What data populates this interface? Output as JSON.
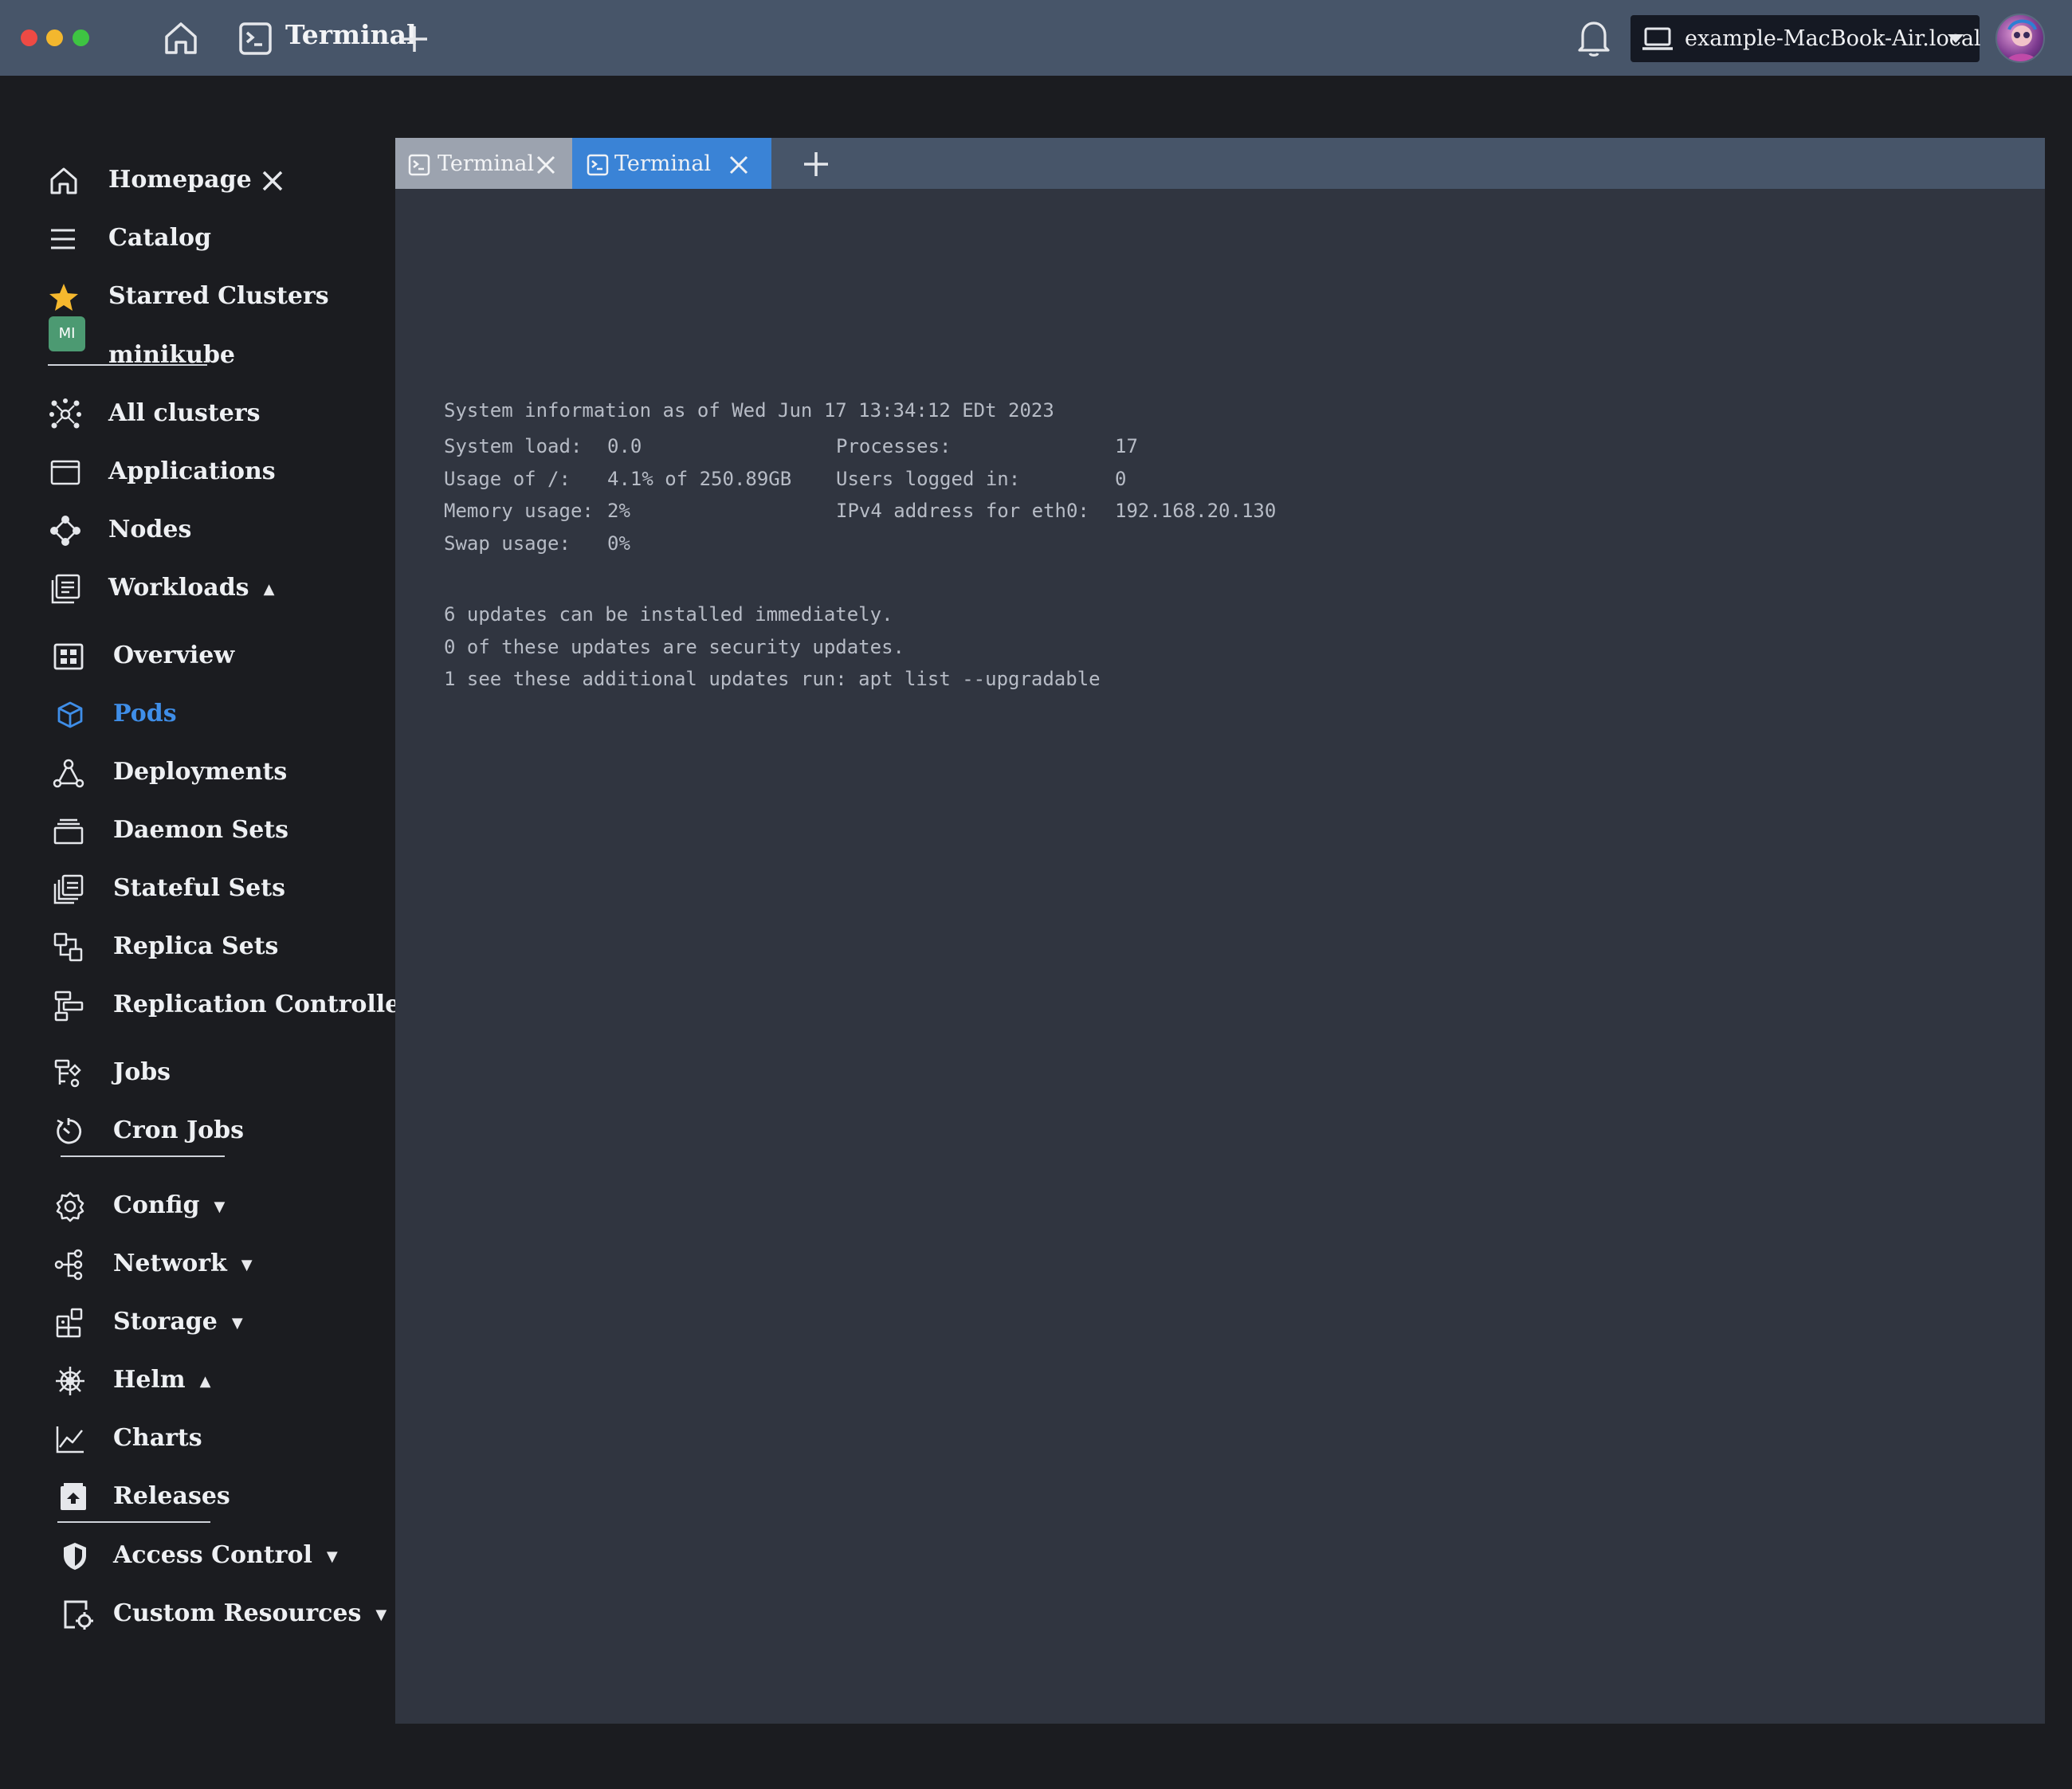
{
  "window": {
    "title": "Terminal",
    "host": "example-MacBook-Air.local"
  },
  "sidebar": {
    "homepage": "Homepage",
    "catalog": "Catalog",
    "starred": "Starred Clusters",
    "cluster_badge": "MI",
    "cluster_name": "minikube",
    "all_clusters": "All clusters",
    "applications": "Applications",
    "nodes": "Nodes",
    "workloads": "Workloads",
    "overview": "Overview",
    "pods": "Pods",
    "deployments": "Deployments",
    "daemon_sets": "Daemon Sets",
    "stateful_sets": "Stateful Sets",
    "replica_sets": "Replica Sets",
    "replication_controllers": "Replication Controllers",
    "jobs": "Jobs",
    "cron_jobs": "Cron Jobs",
    "config": "Config",
    "network": "Network",
    "storage": "Storage",
    "helm": "Helm",
    "charts": "Charts",
    "releases": "Releases",
    "access_control": "Access Control",
    "custom_resources": "Custom Resources"
  },
  "tabs": [
    {
      "label": "Terminal",
      "active": false
    },
    {
      "label": "Terminal",
      "active": true
    }
  ],
  "terminal": {
    "header": "System information as of Wed Jun 17 13:34:12 EDt 2023",
    "left": [
      {
        "k": "System load:",
        "v": "0.0"
      },
      {
        "k": "Usage of /:",
        "v": "4.1% of 250.89GB"
      },
      {
        "k": "Memory usage:",
        "v": "2%"
      },
      {
        "k": "Swap usage:",
        "v": "0%"
      }
    ],
    "right": [
      {
        "k": "Processes:",
        "v": "17"
      },
      {
        "k": "Users logged in:",
        "v": "0"
      },
      {
        "k": "IPv4 address for eth0:",
        "v": "192.168.20.130"
      }
    ],
    "updates": [
      "6 updates can be installed immediately.",
      "0 of these updates are security updates.",
      "1 see these additional updates run: apt list --upgradable"
    ]
  },
  "colors": {
    "accent": "#3a83d6",
    "topbar": "#475569",
    "terminal_bg": "#303540",
    "active_nav": "#3f8ee8",
    "star": "#f5b82e"
  }
}
